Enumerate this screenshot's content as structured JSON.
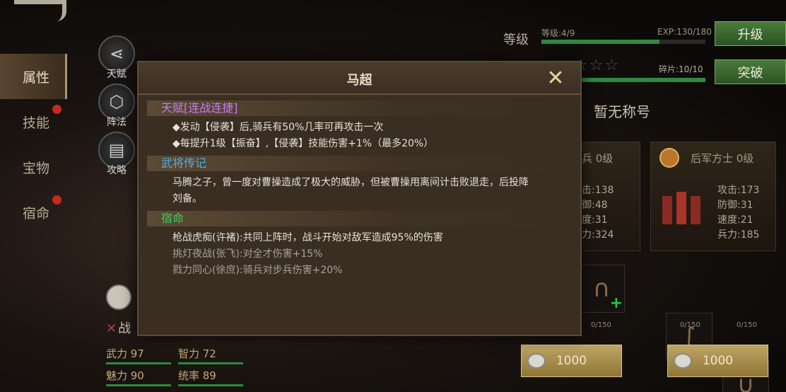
{
  "nav": {
    "items": [
      {
        "label": "属性",
        "active": true,
        "dot": false
      },
      {
        "label": "技能",
        "active": false,
        "dot": true
      },
      {
        "label": "宝物",
        "active": false,
        "dot": false
      },
      {
        "label": "宿命",
        "active": false,
        "dot": true
      }
    ]
  },
  "side_icons": [
    {
      "label": "天赋",
      "icon": "share-icon"
    },
    {
      "label": "阵法",
      "icon": "hexagon-icon"
    },
    {
      "label": "攻略",
      "icon": "book-icon"
    }
  ],
  "hero": {
    "level_label": "等级",
    "level_text": "等级:4/9",
    "exp_text": "EXP:130/180",
    "exp_progress": 0.72,
    "upgrade_button": "升级",
    "fragment_text": "碎片:10/10",
    "fragment_progress": 1.0,
    "breakthrough_button": "突破",
    "title_text": "暂无称号",
    "stars_total": 5,
    "stars_filled": 0
  },
  "cards": [
    {
      "name": "兵 0级",
      "stats": [
        "击:138",
        "御:48",
        "度:31",
        "力:324"
      ]
    },
    {
      "name": "后军方士 0级",
      "stats": [
        "攻击:173",
        "防御:31",
        "速度:21",
        "兵力:185"
      ]
    }
  ],
  "slots": [
    {
      "count": "0/150"
    },
    {
      "count": "0/150"
    },
    {
      "count": "0/150"
    }
  ],
  "cost_buttons": [
    {
      "label": "1000"
    },
    {
      "label": "1000"
    }
  ],
  "bottom_stats": [
    {
      "label": "武力 97"
    },
    {
      "label": "智力 72"
    },
    {
      "label": "魅力 90"
    },
    {
      "label": "统率 89"
    }
  ],
  "battle_label": "战",
  "modal": {
    "title": "马超",
    "sections": [
      {
        "heading": "天赋[连战连捷]",
        "heading_color": "#c77cf0",
        "lines": [
          {
            "text": "◆发动【侵袭】后,骑兵有50%几率可再攻击一次",
            "dim": false
          },
          {
            "text": "◆每提升1级【振奋】,【侵袭】技能伤害+1%（最多20%）",
            "dim": false
          }
        ]
      },
      {
        "heading": "武将传记",
        "heading_color": "#4fb0e8",
        "lines": [
          {
            "text": "马腾之子，曾一度对曹操造成了极大的威胁，但被曹操用离间计击败退走，后投降",
            "dim": false
          },
          {
            "text": "刘备。",
            "dim": false
          }
        ]
      },
      {
        "heading": "宿命",
        "heading_color": "#3ecf5a",
        "lines": [
          {
            "text": "枪战虎痴(许褚):共同上阵时，战斗开始对敌军造成95%的伤害",
            "dim": false
          },
          {
            "text": "挑灯夜战(张飞):对全才伤害+15%",
            "dim": true
          },
          {
            "text": "戮力同心(徐庶):骑兵对步兵伤害+20%",
            "dim": true
          }
        ]
      }
    ]
  }
}
